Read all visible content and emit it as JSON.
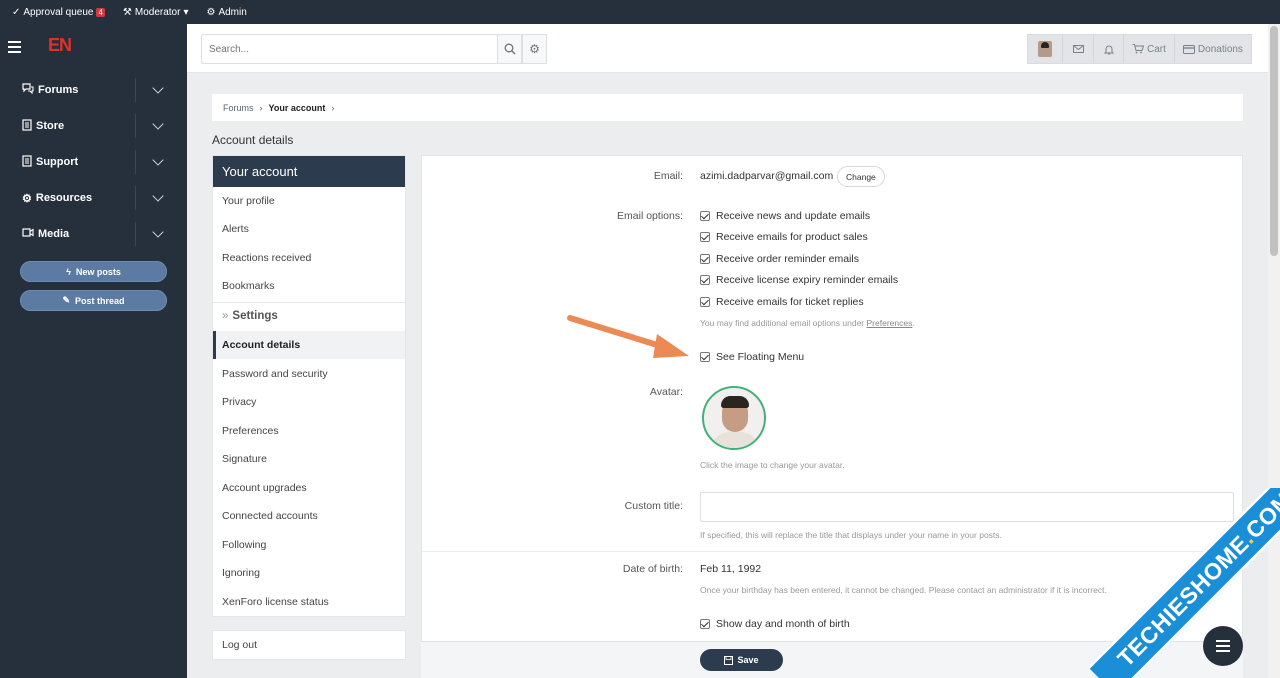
{
  "staffbar": {
    "approval_label": "Approval queue",
    "approval_count": "4",
    "moderator_label": "Moderator",
    "admin_label": "Admin"
  },
  "sidebar": {
    "logo": "EN",
    "items": [
      {
        "label": "Forums",
        "icon": "chat-icon"
      },
      {
        "label": "Store",
        "icon": "document-icon"
      },
      {
        "label": "Support",
        "icon": "document-icon"
      },
      {
        "label": "Resources",
        "icon": "gear-icon"
      },
      {
        "label": "Media",
        "icon": "video-icon"
      }
    ],
    "new_posts_label": "New posts",
    "post_thread_label": "Post thread"
  },
  "header": {
    "search_placeholder": "Search...",
    "cart_label": "Cart",
    "donations_label": "Donations"
  },
  "breadcrumb": {
    "items": [
      "Forums",
      "Your account"
    ]
  },
  "page_title": "Account details",
  "account_menu": {
    "heading": "Your account",
    "items": [
      "Your profile",
      "Alerts",
      "Reactions received",
      "Bookmarks"
    ],
    "settings_label": "Settings",
    "settings_items": [
      "Account details",
      "Password and security",
      "Privacy",
      "Preferences",
      "Signature",
      "Account upgrades",
      "Connected accounts",
      "Following",
      "Ignoring",
      "XenForo license status"
    ],
    "active_item": "Account details",
    "logout_label": "Log out"
  },
  "form": {
    "email_label": "Email:",
    "email_value": "azimi.dadparvar@gmail.com",
    "change_label": "Change",
    "email_options_label": "Email options:",
    "email_options": [
      {
        "label": "Receive news and update emails",
        "checked": true
      },
      {
        "label": "Receive emails for product sales",
        "checked": true
      },
      {
        "label": "Receive order reminder emails",
        "checked": true
      },
      {
        "label": "Receive license expiry reminder emails",
        "checked": true
      },
      {
        "label": "Receive emails for ticket replies",
        "checked": true
      }
    ],
    "email_hint_prefix": "You may find additional email options under ",
    "email_hint_link": "Preferences",
    "email_hint_suffix": ".",
    "floating_menu_label": "See Floating Menu",
    "avatar_label": "Avatar:",
    "avatar_hint": "Click the image to change your avatar.",
    "custom_title_label": "Custom title:",
    "custom_title_value": "",
    "custom_title_hint": "If specified, this will replace the title that displays under your name in your posts.",
    "dob_label": "Date of birth:",
    "dob_value": "Feb 11, 1992",
    "dob_hint": "Once your birthday has been entered, it cannot be changed. Please contact an administrator if it is incorrect.",
    "show_dob_label": "Show day and month of birth",
    "save_label": "Save"
  },
  "watermark": {
    "text": "TECHIESHOME",
    "dot": ".",
    "suffix": "COM"
  },
  "colors": {
    "sidebar_bg": "#26303d",
    "accent": "#2c3b4e",
    "button_blue": "#5b7ba3",
    "arrow": "#ec8a55",
    "avatar_ring": "#43b07a"
  }
}
